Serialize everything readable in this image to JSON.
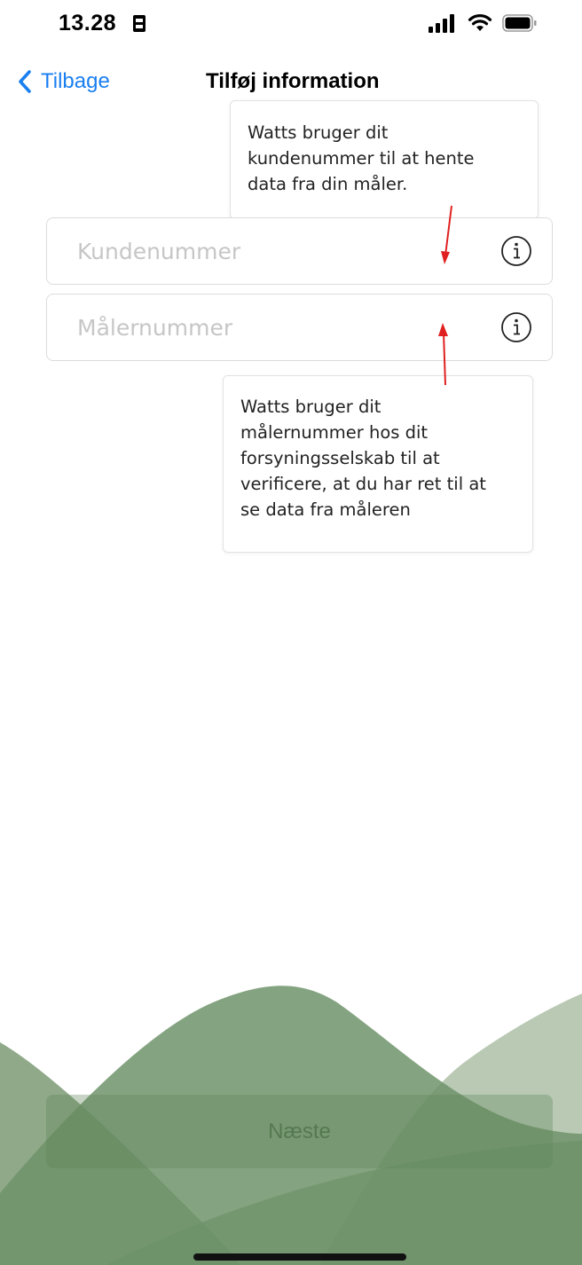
{
  "status_bar": {
    "time": "13.28",
    "icons": [
      "sim-card-icon",
      "cellular-signal-icon",
      "wifi-icon",
      "battery-icon"
    ]
  },
  "nav": {
    "back_label": "Tilbage",
    "title": "Tilføj information"
  },
  "form": {
    "customer_number": {
      "placeholder": "Kundenummer",
      "value": ""
    },
    "meter_number": {
      "placeholder": "Målernummer",
      "value": ""
    }
  },
  "tooltips": {
    "customer_number": {
      "lines": [
        "Watts bruger dit",
        "kundenummer til at hente",
        "data fra din måler."
      ]
    },
    "meter_number": {
      "lines": [
        "Watts bruger dit",
        "målernummer hos dit",
        "forsyningsselskab til at",
        "verificere, at du har ret til at",
        "se data fra måleren"
      ]
    }
  },
  "footer": {
    "next_label": "Næste"
  },
  "colors": {
    "accent_blue": "#1a7ff0",
    "wave_dark": "#6e936a",
    "wave_light": "#b9c9b4",
    "annotation_arrow": "#e02020"
  }
}
